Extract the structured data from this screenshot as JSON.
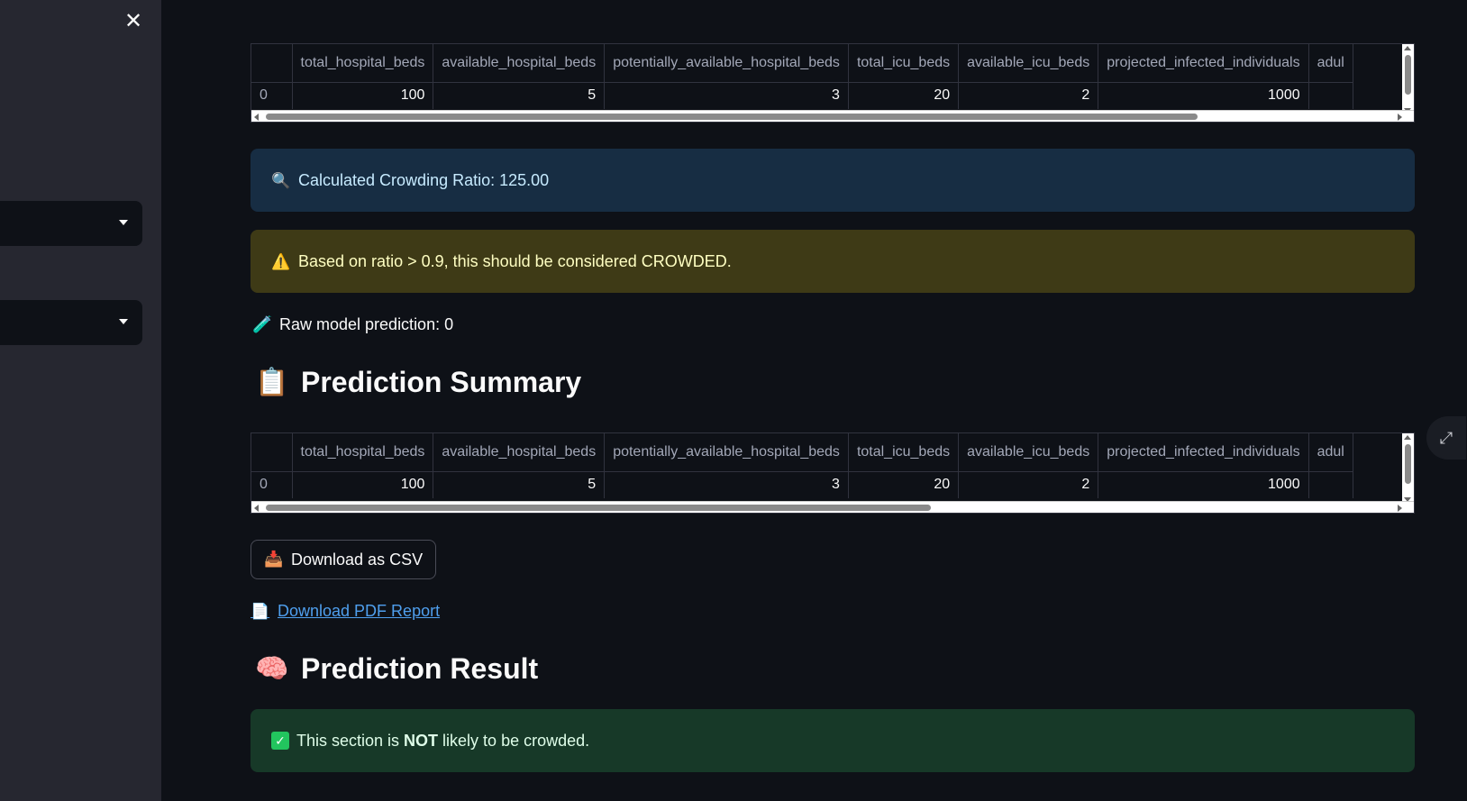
{
  "sidebar": {
    "close_icon": "✕"
  },
  "table_columns": [
    "",
    "total_hospital_beds",
    "available_hospital_beds",
    "potentially_available_hospital_beds",
    "total_icu_beds",
    "available_icu_beds",
    "projected_infected_individuals",
    "adul"
  ],
  "table_rows": [
    [
      "0",
      "100",
      "5",
      "3",
      "20",
      "2",
      "1000",
      ""
    ]
  ],
  "info": {
    "icon": "magnifier-icon",
    "text": "Calculated Crowding Ratio: 125.00"
  },
  "warning": {
    "icon": "warning-icon",
    "text": "Based on ratio > 0.9, this should be considered CROWDED."
  },
  "raw_prediction": {
    "icon": "test-tube-icon",
    "text": "Raw model prediction: 0"
  },
  "summary_heading": {
    "icon": "clipboard-icon",
    "text": "Prediction Summary"
  },
  "download_csv": {
    "icon": "inbox-tray-icon",
    "label": "Download as CSV"
  },
  "download_pdf": {
    "icon": "page-icon",
    "label": "Download PDF Report"
  },
  "result_heading": {
    "icon": "brain-icon",
    "text": "Prediction Result"
  },
  "success": {
    "icon": "check-mark-icon",
    "prefix": "This section is ",
    "bold": "NOT",
    "suffix": " likely to be crowded."
  },
  "colors": {
    "background": "#0e1117",
    "sidebar": "#262730",
    "info_bg": "#172d43",
    "warning_bg": "#3e3a16",
    "success_bg": "#173928",
    "link": "#4f9fee"
  }
}
